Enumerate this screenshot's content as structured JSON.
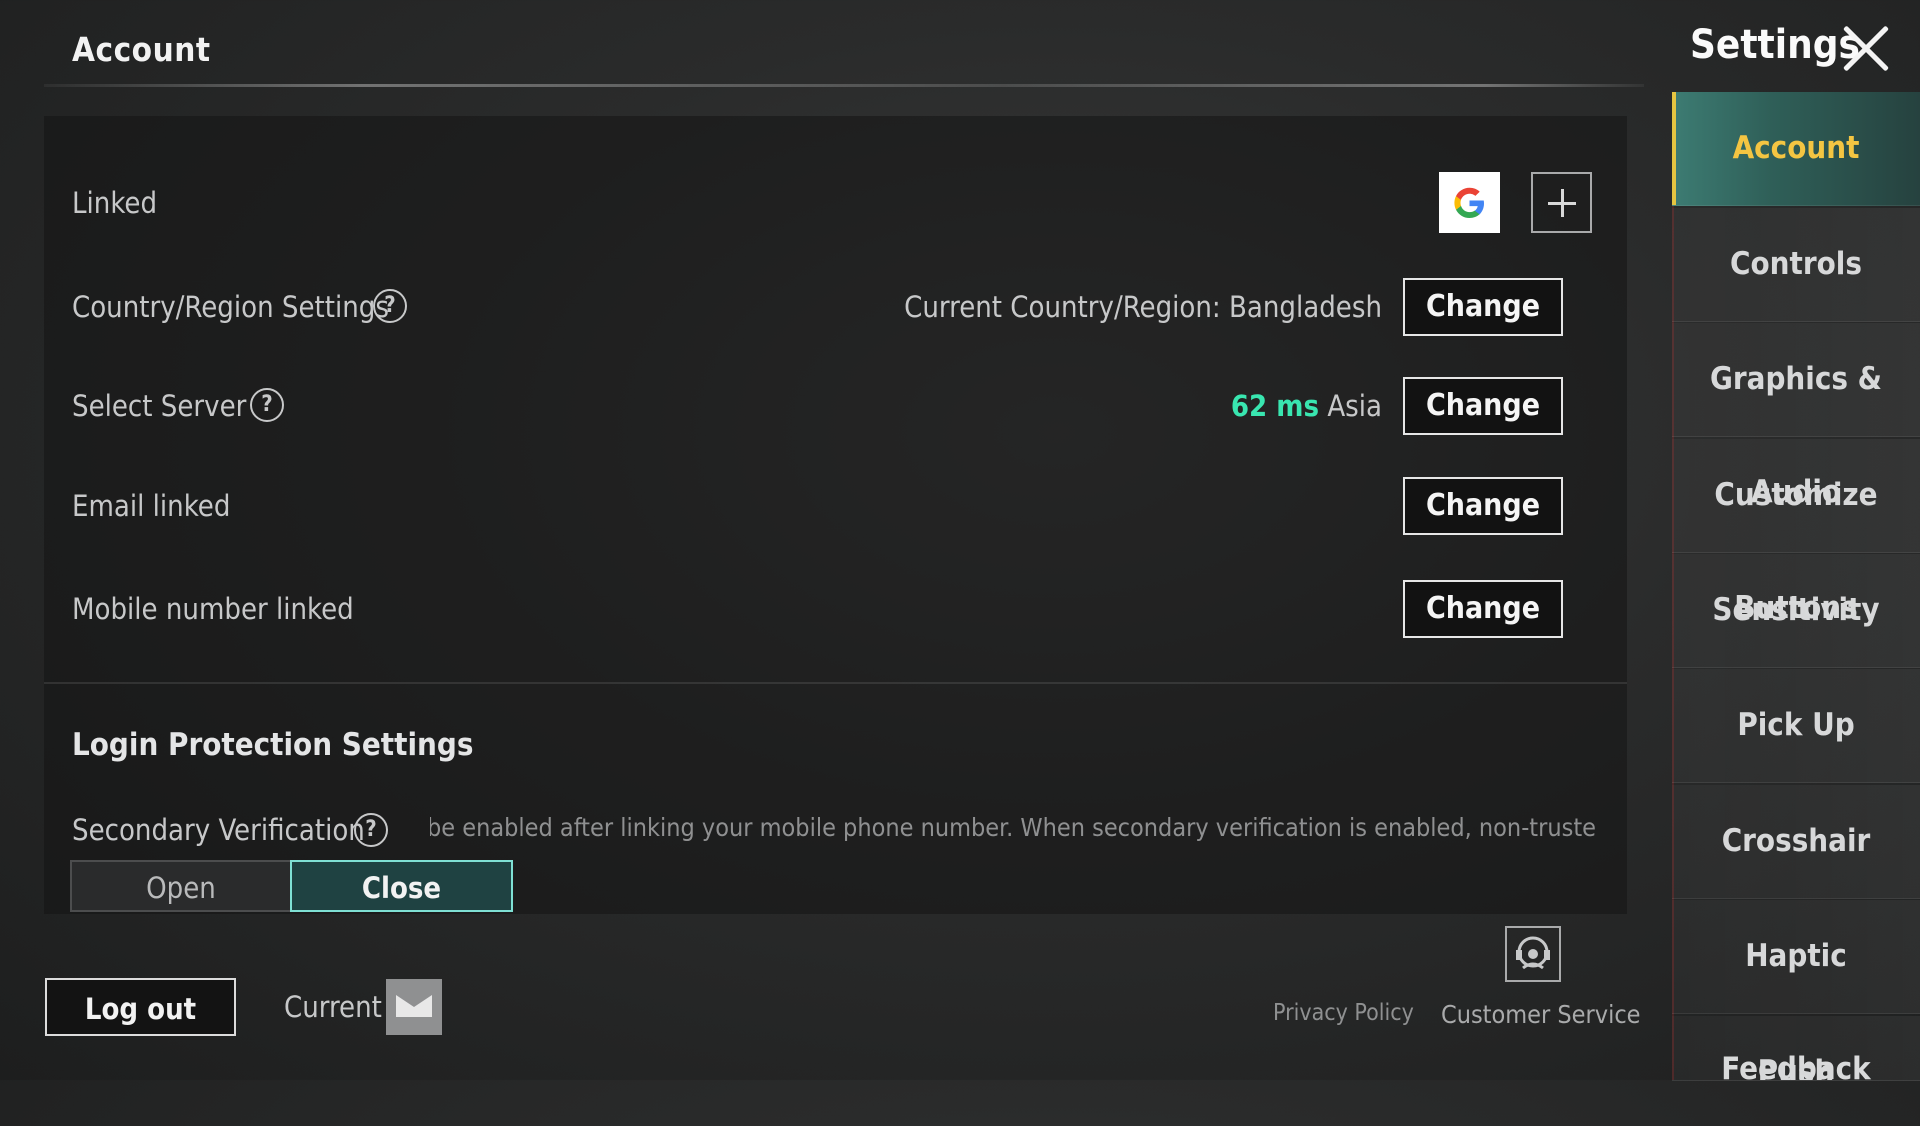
{
  "header": {
    "page_title": "Account",
    "settings_title": "Settings"
  },
  "account": {
    "linked_label": "Linked",
    "country_label": "Country/Region Settings",
    "country_value": "Current Country/Region: Bangladesh",
    "server_label": "Select Server",
    "server_ping": "62 ms",
    "server_region": "Asia",
    "email_label": "Email linked",
    "mobile_label": "Mobile number linked",
    "change_label": "Change",
    "help_glyph": "?"
  },
  "login_protection": {
    "title": "Login Protection Settings",
    "secondary_label": "Secondary Verification",
    "description": "Secondary verification can be enabled after linking your mobile phone number. When secondary verification is enabled, non-truste",
    "open_label": "Open",
    "close_label": "Close",
    "selected": "Close"
  },
  "footer": {
    "logout_label": "Log out",
    "current_label": "Current",
    "privacy_label": "Privacy Policy",
    "customer_service_label": "Customer Service"
  },
  "sidebar": {
    "items": [
      {
        "label": "Account",
        "active": true
      },
      {
        "label": "Controls"
      },
      {
        "label": "Graphics & Audio"
      },
      {
        "label": "Customize Buttons"
      },
      {
        "label": "Sensitivity"
      },
      {
        "label": "Pick Up"
      },
      {
        "label": "Crosshair"
      },
      {
        "label": "Haptic Feedback"
      },
      {
        "label": "Push Notifications"
      }
    ]
  },
  "colors": {
    "accent_teal": "#39e6b0",
    "active_tab_text": "#f4c542",
    "active_tab_bg": "#3d7c73"
  },
  "icons": {
    "google": "google-icon",
    "plus": "plus-icon",
    "help": "help-icon",
    "mail": "mail-icon",
    "customer_service": "headset-icon",
    "close": "close-icon"
  }
}
